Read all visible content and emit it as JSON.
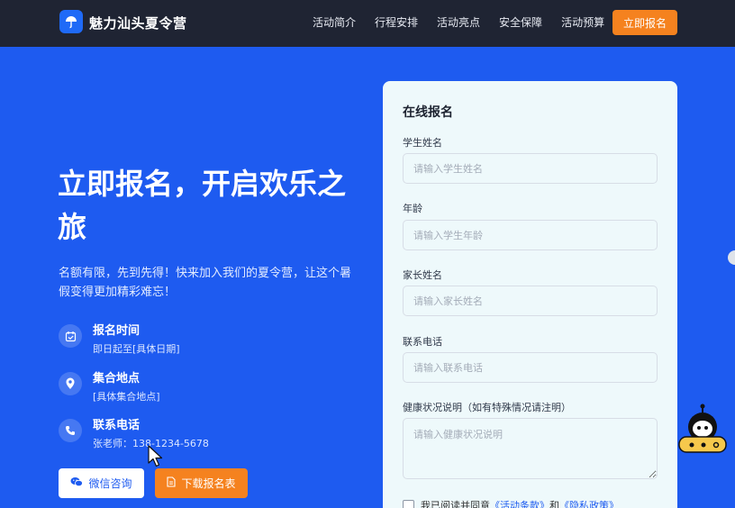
{
  "header": {
    "brand": "魅力汕头夏令营",
    "nav": [
      "活动简介",
      "行程安排",
      "活动亮点",
      "安全保障",
      "活动预算"
    ],
    "signup_label": "立即报名"
  },
  "hero": {
    "title": "立即报名，开启欢乐之旅",
    "description": "名额有限，先到先得！快来加入我们的夏令营，让这个暑假变得更加精彩难忘！",
    "info": [
      {
        "title": "报名时间",
        "sub": "即日起至[具体日期]"
      },
      {
        "title": "集合地点",
        "sub": "[具体集合地点]"
      },
      {
        "title": "联系电话",
        "sub": "张老师：138-1234-5678"
      }
    ],
    "wechat_label": "微信咨询",
    "download_label": "下载报名表"
  },
  "form": {
    "title": "在线报名",
    "fields": [
      {
        "label": "学生姓名",
        "placeholder": "请输入学生姓名"
      },
      {
        "label": "年龄",
        "placeholder": "请输入学生年龄"
      },
      {
        "label": "家长姓名",
        "placeholder": "请输入家长姓名"
      },
      {
        "label": "联系电话",
        "placeholder": "请输入联系电话"
      }
    ],
    "health_label": "健康状况说明（如有特殊情况请注明）",
    "health_placeholder": "请输入健康状况说明",
    "agree_prefix": "我已阅读并同意",
    "terms_link": "《活动条款》",
    "agree_and": "和",
    "privacy_link": "《隐私政策》"
  },
  "colors": {
    "hero_bg": "#1e5bf0",
    "header_bg": "#1f2433",
    "accent_orange": "#f5821f",
    "card_bg": "#eef9fb"
  },
  "icons": {
    "logo": "umbrella-icon",
    "info": [
      "calendar-icon",
      "location-pin-icon",
      "phone-icon"
    ],
    "wechat": "wechat-icon",
    "download": "document-icon"
  }
}
